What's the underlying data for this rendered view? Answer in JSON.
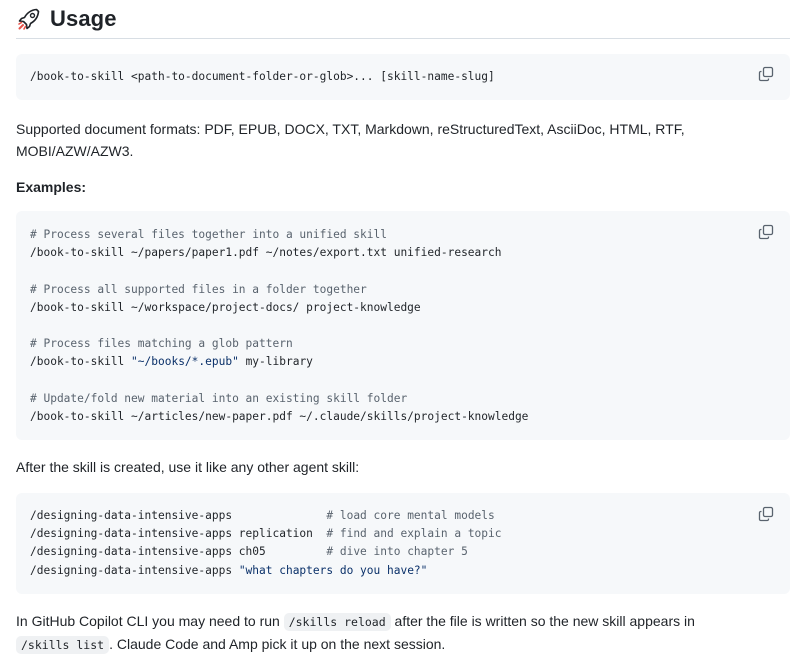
{
  "heading": {
    "title": "Usage",
    "icon": "rocket-icon"
  },
  "usage_block": {
    "line": "/book-to-skill <path-to-document-folder-or-glob>... [skill-name-slug]"
  },
  "supported_formats": {
    "text": "Supported document formats: PDF, EPUB, DOCX, TXT, Markdown, reStructuredText, AsciiDoc, HTML, RTF, MOBI/AZW/AZW3."
  },
  "examples_label": "Examples:",
  "examples_block": {
    "comment1": "# Process several files together into a unified skill",
    "cmd1": "/book-to-skill ~/papers/paper1.pdf ~/notes/export.txt unified-research",
    "comment2": "# Process all supported files in a folder together",
    "cmd2": "/book-to-skill ~/workspace/project-docs/ project-knowledge",
    "comment3": "# Process files matching a glob pattern",
    "cmd3_prefix": "/book-to-skill ",
    "cmd3_string": "\"~/books/*.epub\"",
    "cmd3_suffix": " my-library",
    "comment4": "# Update/fold new material into an existing skill folder",
    "cmd4": "/book-to-skill ~/articles/new-paper.pdf ~/.claude/skills/project-knowledge"
  },
  "after_text": "After the skill is created, use it like any other agent skill:",
  "skill_block": {
    "row1_cmd": "/designing-data-intensive-apps              ",
    "row1_comment": "# load core mental models",
    "row2_cmd": "/designing-data-intensive-apps replication  ",
    "row2_comment": "# find and explain a topic",
    "row3_cmd": "/designing-data-intensive-apps ch05         ",
    "row3_comment": "# dive into chapter 5",
    "row4_prefix": "/designing-data-intensive-apps ",
    "row4_string": "\"what chapters do you have?\""
  },
  "final_para": {
    "part1": "In GitHub Copilot CLI you may need to run ",
    "code1": "/skills reload",
    "part2": " after the file is written so the new skill appears in",
    "code2": "/skills list",
    "part3": ". Claude Code and Amp pick it up on the next session."
  },
  "colors": {
    "code_bg": "#f6f8fa",
    "comment": "#59636e",
    "string": "#0a3069",
    "rocket_body": "#1f2328",
    "rocket_fin": "#e5534b"
  }
}
